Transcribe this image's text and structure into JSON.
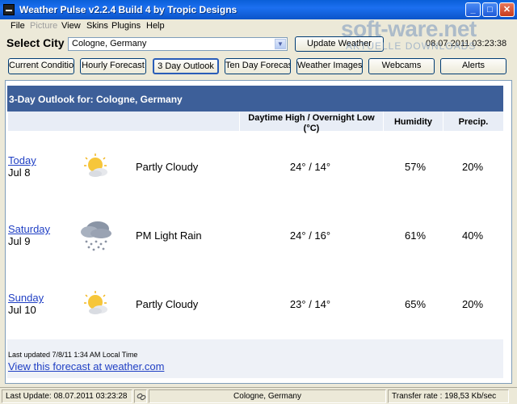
{
  "window": {
    "title": "Weather Pulse v2.2.4 Build 4 by Tropic Designs",
    "controls": {
      "minimize": "_",
      "maximize": "□",
      "close": "✕"
    }
  },
  "watermark": {
    "brand": "soft-ware.net",
    "tagline": "AKTUELLE DOWNLOADS"
  },
  "menu": [
    {
      "label": "File",
      "enabled": true
    },
    {
      "label": "Picture",
      "enabled": false
    },
    {
      "label": "View",
      "enabled": true
    },
    {
      "label": "Skins",
      "enabled": true
    },
    {
      "label": "Plugins",
      "enabled": true
    },
    {
      "label": "Help",
      "enabled": true
    }
  ],
  "city": {
    "label": "Select City",
    "selected": "Cologne, Germany",
    "update_button": "Update Weather",
    "timestamp": "08.07.2011 03:23:38"
  },
  "tabs": [
    "Current Conditions",
    "Hourly Forecast",
    "3 Day Outlook",
    "Ten Day Forecast",
    "Weather Images",
    "Webcams",
    "Alerts"
  ],
  "active_tab": "3 Day Outlook",
  "outlook": {
    "header": "3-Day Outlook for: Cologne, Germany",
    "columns": {
      "temp": "Daytime High / Overnight Low (°C)",
      "humidity": "Humidity",
      "precip": "Precip."
    },
    "days": [
      {
        "day": "Today",
        "date": "Jul 8",
        "icon": "partly-cloudy-icon",
        "condition": "Partly Cloudy",
        "temp": "24° / 14°",
        "humidity": "57%",
        "precip": "20%"
      },
      {
        "day": "Saturday",
        "date": "Jul 9",
        "icon": "rain-cloud-icon",
        "condition": "PM Light Rain",
        "temp": "24° / 16°",
        "humidity": "61%",
        "precip": "40%"
      },
      {
        "day": "Sunday",
        "date": "Jul 10",
        "icon": "partly-cloudy-icon",
        "condition": "Partly Cloudy",
        "temp": "23° / 14°",
        "humidity": "65%",
        "precip": "20%"
      }
    ],
    "last_updated": "Last updated 7/8/11 1:34 AM Local Time",
    "link": "View this forecast at weather.com"
  },
  "status": {
    "last_update": "Last Update: 08.07.2011 03:23:28",
    "city": "Cologne, Germany",
    "transfer": "Transfer rate : 198,53 Kb/sec"
  },
  "colors": {
    "title_bar": "#0a5fd8",
    "header_band": "#3d5f99",
    "column_header_bg": "#e8edf6",
    "link": "#1f3fc4"
  }
}
